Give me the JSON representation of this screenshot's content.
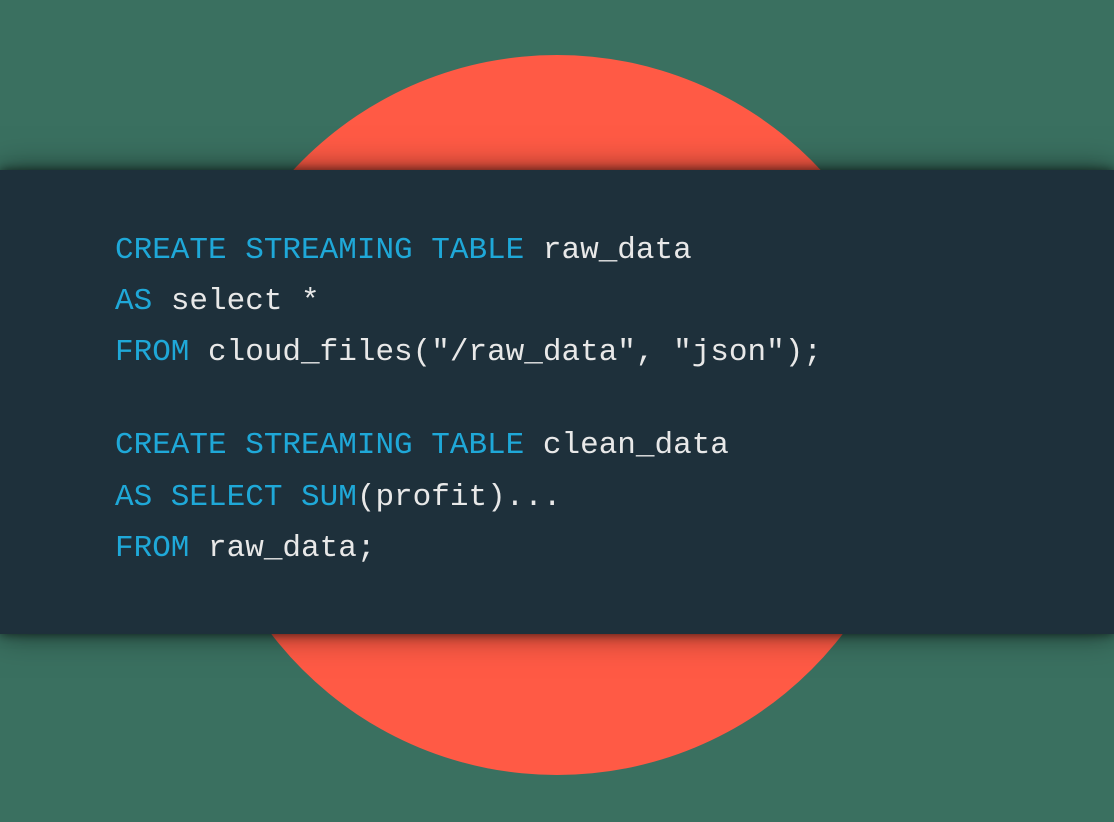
{
  "code": {
    "line1": {
      "kw1": "CREATE STREAMING TABLE",
      "t1": " raw_data"
    },
    "line2": {
      "kw1": "AS",
      "t1": " select *"
    },
    "line3": {
      "kw1": "FROM",
      "t1": " cloud_files(\"/raw_data\", \"json\");"
    },
    "line4": {
      "kw1": "CREATE STREAMING TABLE",
      "t1": " clean_data"
    },
    "line5": {
      "kw1": "AS SELECT SUM",
      "t1": "(profit)..."
    },
    "line6": {
      "kw1": "FROM",
      "t1": " raw_data;"
    }
  }
}
